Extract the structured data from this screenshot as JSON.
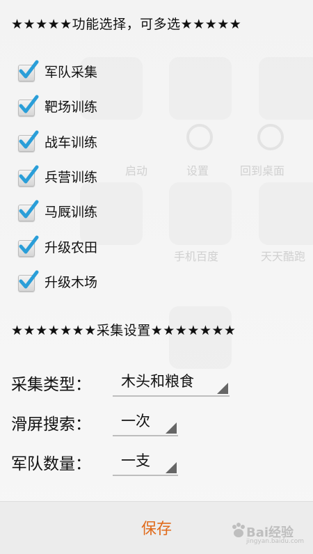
{
  "header": {
    "options_title": "★★★★★功能选择，可多选★★★★★",
    "settings_title": "★★★★★★★采集设置★★★★★★★"
  },
  "options": [
    {
      "label": "军队采集",
      "checked": true
    },
    {
      "label": "靶场训练",
      "checked": true
    },
    {
      "label": "战车训练",
      "checked": true
    },
    {
      "label": "兵营训练",
      "checked": true
    },
    {
      "label": "马厩训练",
      "checked": true
    },
    {
      "label": "升级农田",
      "checked": true
    },
    {
      "label": "升级木场",
      "checked": true
    }
  ],
  "settings": {
    "collect_type": {
      "label": "采集类型：",
      "value": "木头和粮食"
    },
    "swipe_search": {
      "label": "滑屏搜索：",
      "value": "一次"
    },
    "army_count": {
      "label": "军队数量：",
      "value": "一支"
    }
  },
  "footer": {
    "save_label": "保存",
    "watermark": "Bai经验",
    "watermark_sub": "jingyan.baidu.com"
  },
  "colors": {
    "accent_check": "#2a9ed8",
    "save_text": "#e06a1a"
  },
  "background_app_labels": [
    "启动",
    "设置",
    "回到桌面",
    "手机百度",
    "天天酷跑"
  ]
}
